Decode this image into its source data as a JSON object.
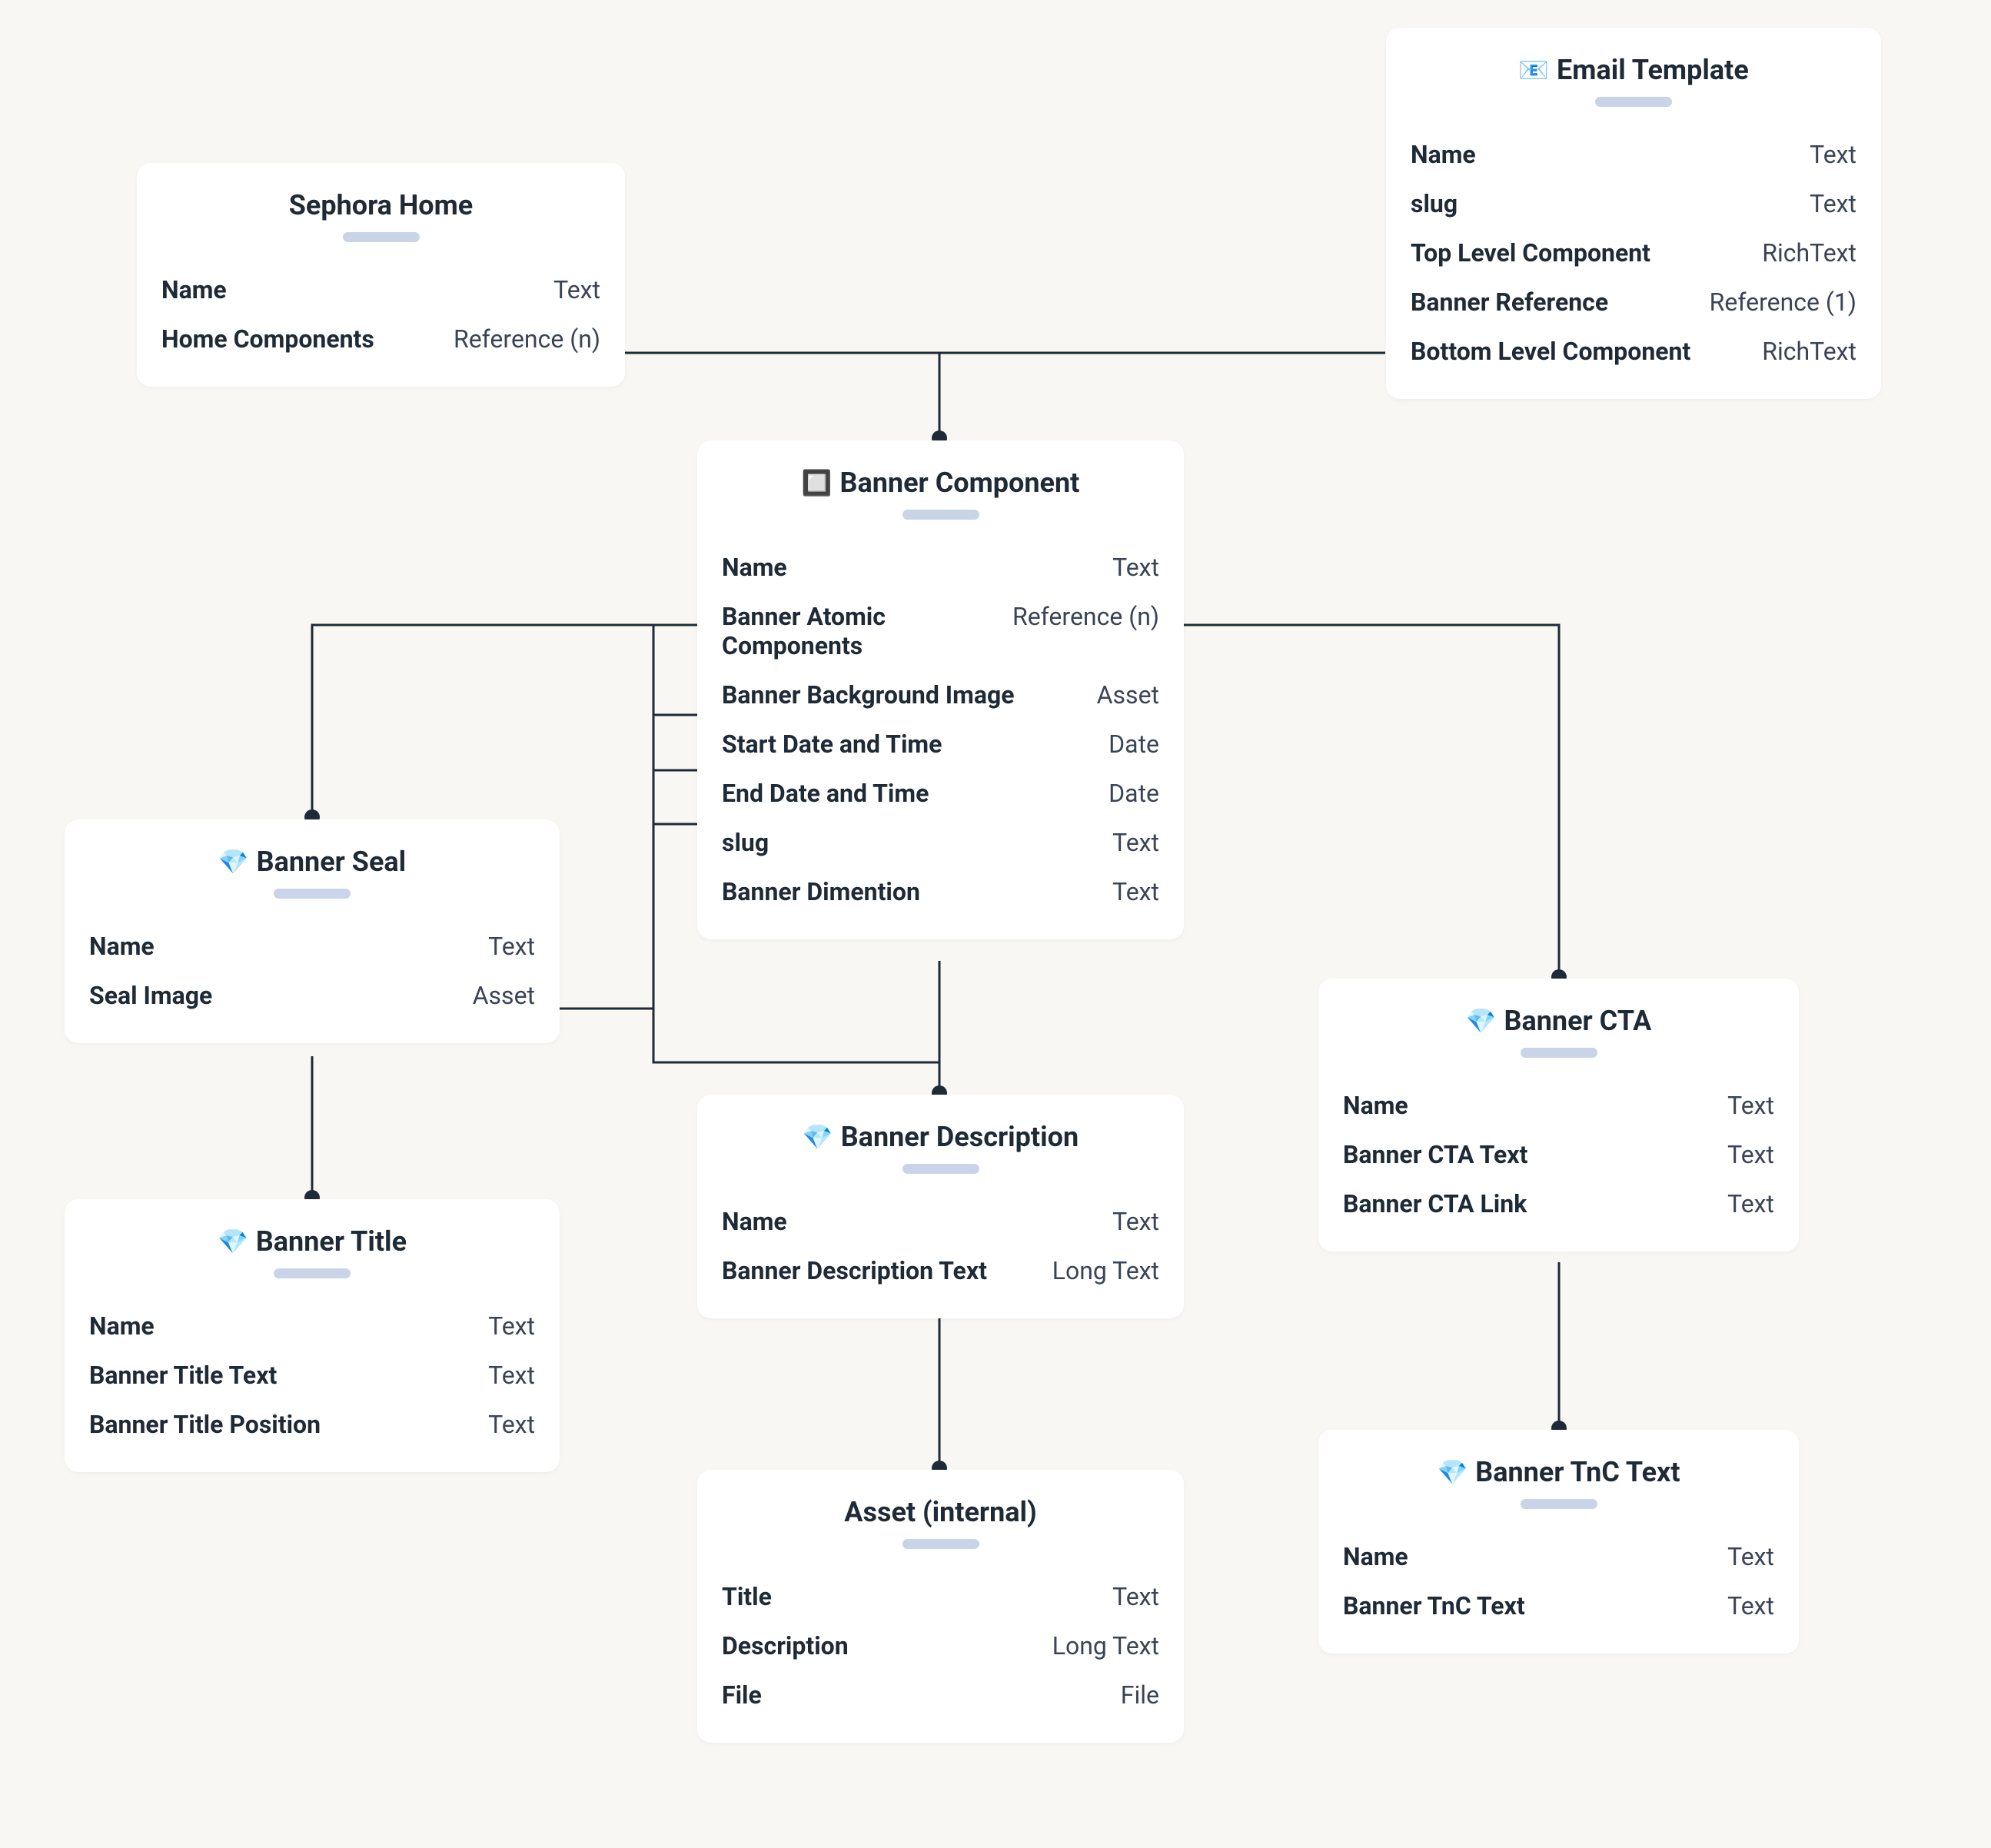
{
  "nodes": {
    "sephora_home": {
      "title": "Sephora Home",
      "icon": "",
      "fields": [
        {
          "name": "Name",
          "type": "Text"
        },
        {
          "name": "Home Components",
          "type": "Reference (n)"
        }
      ]
    },
    "email_template": {
      "title": "Email Template",
      "icon": "📧",
      "fields": [
        {
          "name": "Name",
          "type": "Text"
        },
        {
          "name": "slug",
          "type": "Text"
        },
        {
          "name": "Top Level Component",
          "type": "RichText"
        },
        {
          "name": "Banner Reference",
          "type": "Reference (1)"
        },
        {
          "name": "Bottom Level Component",
          "type": "RichText"
        }
      ]
    },
    "banner_component": {
      "title": "Banner Component",
      "icon": "🔲",
      "fields": [
        {
          "name": "Name",
          "type": "Text"
        },
        {
          "name": "Banner Atomic Components",
          "type": "Reference (n)"
        },
        {
          "name": "Banner Background Image",
          "type": "Asset"
        },
        {
          "name": "Start Date and Time",
          "type": "Date"
        },
        {
          "name": "End Date and Time",
          "type": "Date"
        },
        {
          "name": "slug",
          "type": "Text"
        },
        {
          "name": "Banner Dimention",
          "type": "Text"
        }
      ]
    },
    "banner_seal": {
      "title": "Banner Seal",
      "icon": "💎",
      "fields": [
        {
          "name": "Name",
          "type": "Text"
        },
        {
          "name": "Seal Image",
          "type": "Asset"
        }
      ]
    },
    "banner_title": {
      "title": "Banner Title",
      "icon": "💎",
      "fields": [
        {
          "name": "Name",
          "type": "Text"
        },
        {
          "name": "Banner Title Text",
          "type": "Text"
        },
        {
          "name": "Banner Title Position",
          "type": "Text"
        }
      ]
    },
    "banner_description": {
      "title": "Banner Description",
      "icon": "💎",
      "fields": [
        {
          "name": "Name",
          "type": "Text"
        },
        {
          "name": "Banner Description Text",
          "type": "Long Text"
        }
      ]
    },
    "banner_cta": {
      "title": "Banner CTA",
      "icon": "💎",
      "fields": [
        {
          "name": "Name",
          "type": "Text"
        },
        {
          "name": "Banner CTA Text",
          "type": "Text"
        },
        {
          "name": "Banner CTA Link",
          "type": "Text"
        }
      ]
    },
    "banner_tnc": {
      "title": "Banner TnC Text",
      "icon": "💎",
      "fields": [
        {
          "name": "Name",
          "type": "Text"
        },
        {
          "name": "Banner TnC Text",
          "type": "Text"
        }
      ]
    },
    "asset_internal": {
      "title": "Asset (internal)",
      "icon": "",
      "fields": [
        {
          "name": "Title",
          "type": "Text"
        },
        {
          "name": "Description",
          "type": "Long Text"
        },
        {
          "name": "File",
          "type": "File"
        }
      ]
    }
  }
}
